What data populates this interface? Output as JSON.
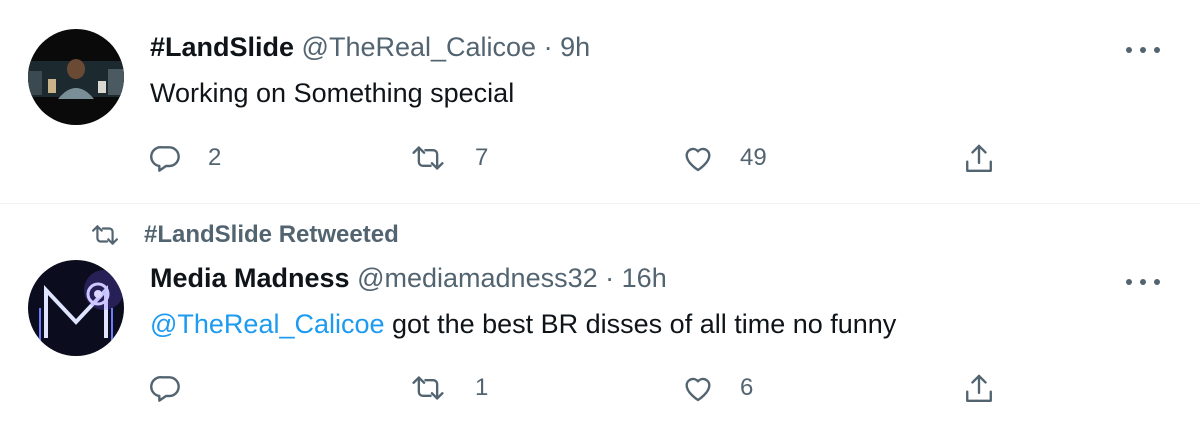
{
  "colors": {
    "text": "#0f1419",
    "secondary": "#536471",
    "link": "#1d9bf0",
    "divider": "#eff3f4"
  },
  "tweets": [
    {
      "name": "#LandSlide",
      "handle": "@TheReal_Calicoe",
      "separator": "·",
      "time": "9h",
      "text": "Working on Something special",
      "actions": {
        "reply_count": "2",
        "retweet_count": "7",
        "like_count": "49"
      }
    },
    {
      "retweet_context": "#LandSlide Retweeted",
      "name": "Media Madness",
      "handle": "@mediamadness32",
      "separator": "·",
      "time": "16h",
      "mention": "@TheReal_Calicoe",
      "text": " got the best BR disses of all time no funny",
      "actions": {
        "reply_count": "",
        "retweet_count": "1",
        "like_count": "6"
      }
    }
  ],
  "icons": {
    "more": "more-icon",
    "reply": "reply-icon",
    "retweet": "retweet-icon",
    "like": "like-icon",
    "share": "share-icon"
  }
}
